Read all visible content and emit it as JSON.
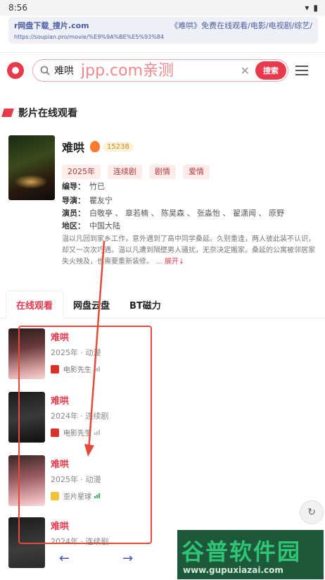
{
  "status": {
    "time": "8:56"
  },
  "url_card": {
    "left_text": "r网盘下载_搜片.com",
    "right_text": "《难哄》免费在线观看/电影/电视剧/综艺/",
    "url": "https://soupian.pro/movie/%E9%9A%BE%E5%93%84"
  },
  "search": {
    "value": "难哄",
    "watermark": "jpp.com亲测",
    "button_label": "搜索"
  },
  "section": {
    "title": "影片在线观看"
  },
  "movie": {
    "title": "难哄",
    "heat": "15238",
    "tags": [
      "2025年",
      "连续剧",
      "剧情",
      "爱情"
    ],
    "writer_label": "编导：",
    "writer": "竹已",
    "director_label": "导演：",
    "director": "瞿友宁",
    "cast_label": "演员：",
    "cast": "白敬亭 、 章若楠 、 陈昊森 、 张淼怡 、 翟潇闻 、 原野",
    "region_label": "地区：",
    "region": "中国大陆",
    "description": "温以凡回到家乡工作，意外遇到了高中同学桑延。久别重逢，两人彼此装不认识，却又一次次巧遇。温以凡遭到隔壁男人骚扰，无奈决定搬家。桑延的公寓被邻居家失火殃及，也需要重新装修。",
    "expand_label": "... 展开↓"
  },
  "tabs": [
    "在线观看",
    "网盘云盘",
    "BT磁力"
  ],
  "results": [
    {
      "name": "难哄",
      "meta": "2025年 · 动漫",
      "source": "电影先生"
    },
    {
      "name": "难哄",
      "meta": "2024年 · 连续剧",
      "source": "电影先生"
    },
    {
      "name": "难哄",
      "meta": "2025年 · 动漫",
      "source": "歪片星球"
    },
    {
      "name": "难哄",
      "meta": "2024年 · 连续剧",
      "source": ""
    }
  ],
  "pager": {
    "prev": "←",
    "next": "→"
  },
  "watermark": {
    "big": "谷普软件园",
    "small": "www.gupuxiazai.com"
  },
  "colors": {
    "accent": "#e8394d",
    "link": "#3b56b0"
  }
}
